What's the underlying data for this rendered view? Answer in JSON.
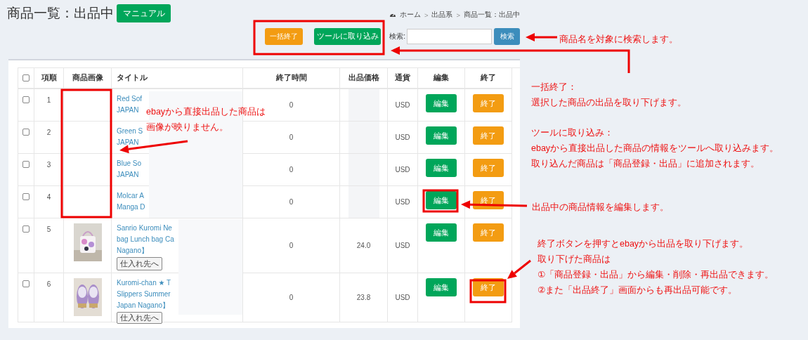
{
  "page_title": "商品一覧：出品中",
  "manual_button": "マニュアル",
  "breadcrumb": {
    "items": [
      "ホーム",
      "出品系",
      "商品一覧：出品中"
    ],
    "separator": ">"
  },
  "toolbar": {
    "bulk_end_button": "一括終了",
    "import_button": "ツールに取り込み",
    "search_label": "検索:",
    "search_button": "検索"
  },
  "table": {
    "select_all": {
      "checked": false
    },
    "columns": [
      "項順",
      "商品画像",
      "タイトル",
      "終了時間",
      "出品価格",
      "通貨",
      "編集",
      "終了"
    ],
    "rows": [
      {
        "checked": false,
        "number": "1",
        "title_lines": [
          "Red Sof",
          "JAPAN"
        ],
        "end_time": "0",
        "currency": "USD",
        "edit_button": "編集",
        "end_button": "終了"
      },
      {
        "checked": false,
        "number": "2",
        "title_lines": [
          "Green S",
          "JAPAN"
        ],
        "end_time": "0",
        "currency": "USD",
        "edit_button": "編集",
        "end_button": "終了"
      },
      {
        "checked": false,
        "number": "3",
        "title_lines": [
          "Blue So",
          "JAPAN"
        ],
        "end_time": "0",
        "currency": "USD",
        "edit_button": "編集",
        "end_button": "終了"
      },
      {
        "checked": false,
        "number": "4",
        "title_lines": [
          "Molcar A",
          "Manga D"
        ],
        "end_time": "0",
        "currency": "USD",
        "edit_button": "編集",
        "end_button": "終了"
      },
      {
        "checked": false,
        "number": "5",
        "image": {
          "kind": "picture"
        },
        "title_lines": [
          "Sanrio Kuromi Ne",
          "bag Lunch bag Ca",
          "Nagano】"
        ],
        "supplier_button": "仕入れ先へ",
        "end_time": "0",
        "price": "24.0",
        "currency": "USD",
        "edit_button": "編集",
        "end_button": "終了"
      },
      {
        "checked": false,
        "number": "6",
        "image": {
          "kind": "picture"
        },
        "title_lines": [
          "Kuromi-chan ★ T",
          "Slippers Summer",
          "Japan Nagano】"
        ],
        "supplier_button": "仕入れ先へ",
        "end_time": "0",
        "price": "23.8",
        "currency": "USD",
        "edit_button": "編集",
        "end_button": "終了"
      }
    ]
  },
  "annotations": [
    {
      "lines": [
        "商品名を対象に検索します。"
      ]
    },
    {
      "lines": [
        "一括終了：",
        "選択した商品の出品を取り下げます。"
      ]
    },
    {
      "lines": [
        "ツールに取り込み：",
        "ebayから直接出品した商品の情報をツールへ取り込みます。",
        "取り込んだ商品は「商品登録・出品」に追加されます。"
      ]
    },
    {
      "lines": [
        "ebayから直接出品した商品は",
        "画像が映りません。"
      ]
    },
    {
      "lines": [
        "出品中の商品情報を編集します。"
      ]
    },
    {
      "lines": [
        "終了ボタンを押すとebayから出品を取り下げます。",
        "取り下げた商品は",
        "①「商品登録・出品」から編集・削除・再出品できます。",
        "②また「出品終了」画面からも再出品可能です。"
      ]
    }
  ]
}
